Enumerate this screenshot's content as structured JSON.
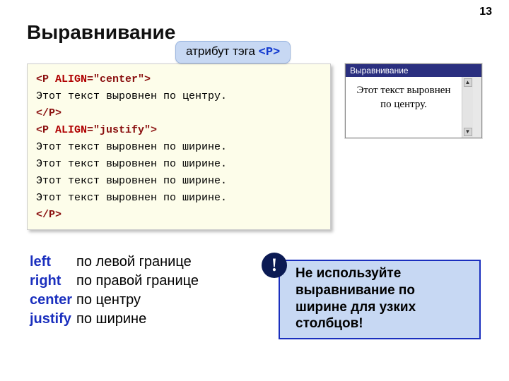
{
  "page_number": "13",
  "title": "Выравнивание",
  "callout": {
    "text": "атрибут тэга ",
    "tag": "<P>"
  },
  "code": {
    "l1_open": "<P",
    "l1_attr": " ALIGN",
    "l1_rest": "=\"center\">",
    "l2": "Этот текст выровнен по центру.",
    "l3": "</P>",
    "l4_open": "<P",
    "l4_attr": " ALIGN",
    "l4_rest": "=\"justify\">",
    "l5": "Этот текст выровнен по ширине.",
    "l6": "Этот текст выровнен по ширине.",
    "l7": "Этот текст выровнен по ширине.",
    "l8": "Этот текст выровнен по ширине.",
    "l9": "</P>"
  },
  "preview": {
    "window_title": "Выравнивание",
    "body": "Этот текст выровнен по центру."
  },
  "legend": [
    {
      "kw": "left",
      "desc": "по левой границе"
    },
    {
      "kw": "right",
      "desc": "по правой границе"
    },
    {
      "kw": "center",
      "desc": "по центру"
    },
    {
      "kw": "justify",
      "desc": "по ширине"
    }
  ],
  "warning": {
    "mark": "!",
    "text": "Не используйте выравнивание по ширине для узких столбцов!"
  }
}
